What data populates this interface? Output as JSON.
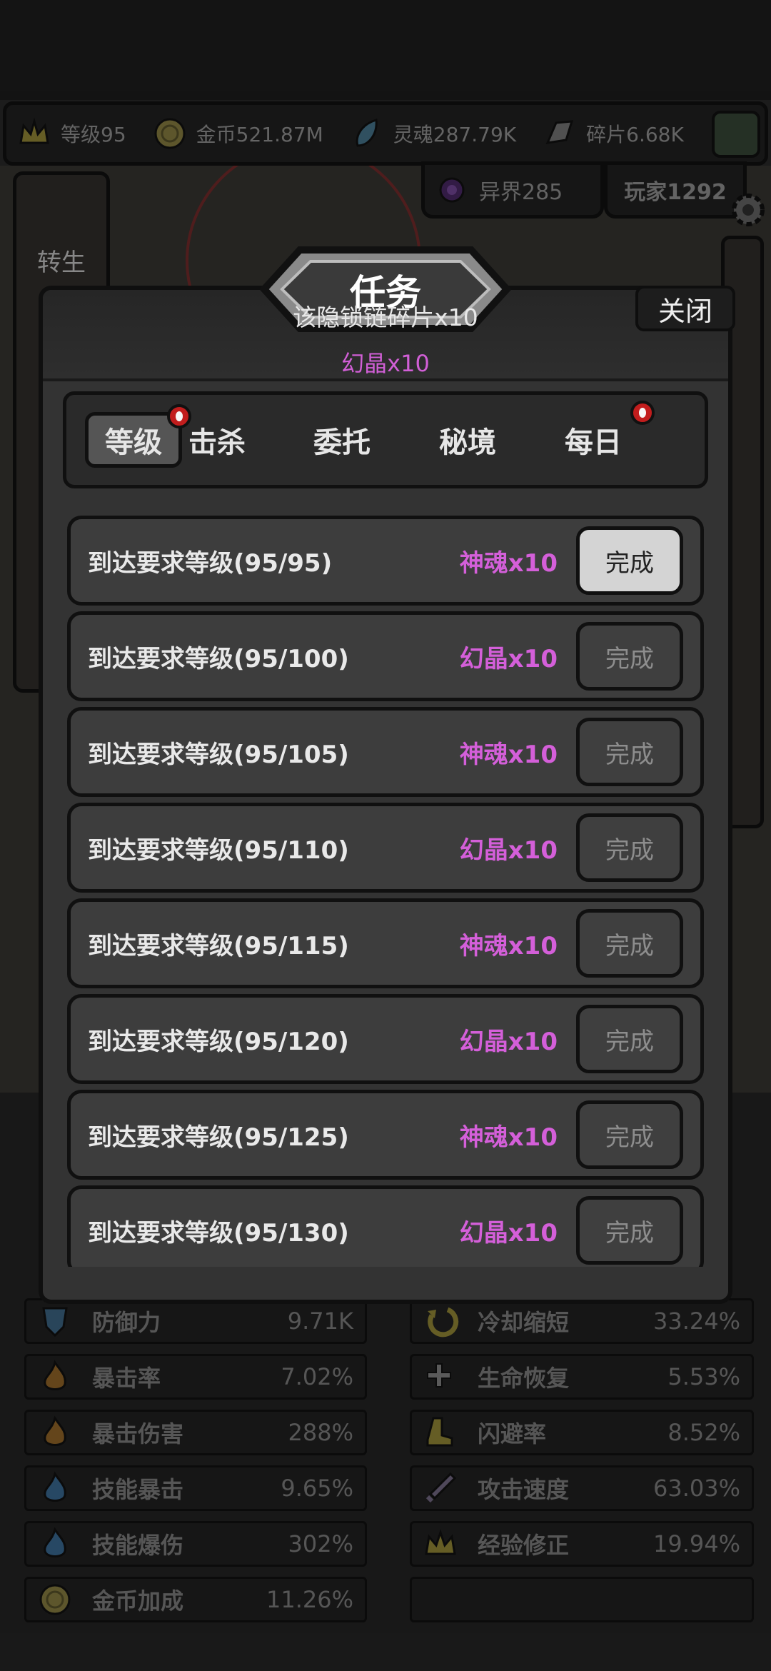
{
  "top_stats": [
    {
      "label": "等级95",
      "icon": "crown-icon"
    },
    {
      "label": "金币521.87M",
      "icon": "coin-icon"
    },
    {
      "label": "灵魂287.79K",
      "icon": "soul-icon"
    },
    {
      "label": "碎片6.68K",
      "icon": "shard-icon"
    }
  ],
  "sub_tabs": {
    "realm": "异界285",
    "player": "玩家1292"
  },
  "side": {
    "rebirth": "转生"
  },
  "modal": {
    "title": "任务",
    "close": "关闭",
    "toast": "该隐锁链碎片x10",
    "toast_sub": "幻晶x10"
  },
  "tabs": [
    {
      "label": "等级",
      "active": true,
      "badge": true
    },
    {
      "label": "击杀",
      "active": false,
      "badge": false
    },
    {
      "label": "委托",
      "active": false,
      "badge": false
    },
    {
      "label": "秘境",
      "active": false,
      "badge": false
    },
    {
      "label": "每日",
      "active": false,
      "badge": true
    }
  ],
  "quests": [
    {
      "text": "到达要求等级(95/95)",
      "reward": "神魂x10",
      "button": "完成",
      "ready": true
    },
    {
      "text": "到达要求等级(95/100)",
      "reward": "幻晶x10",
      "button": "完成",
      "ready": false
    },
    {
      "text": "到达要求等级(95/105)",
      "reward": "神魂x10",
      "button": "完成",
      "ready": false
    },
    {
      "text": "到达要求等级(95/110)",
      "reward": "幻晶x10",
      "button": "完成",
      "ready": false
    },
    {
      "text": "到达要求等级(95/115)",
      "reward": "神魂x10",
      "button": "完成",
      "ready": false
    },
    {
      "text": "到达要求等级(95/120)",
      "reward": "幻晶x10",
      "button": "完成",
      "ready": false
    },
    {
      "text": "到达要求等级(95/125)",
      "reward": "神魂x10",
      "button": "完成",
      "ready": false
    },
    {
      "text": "到达要求等级(95/130)",
      "reward": "幻晶x10",
      "button": "完成",
      "ready": false
    }
  ],
  "attributes_left": [
    {
      "label": "防御力",
      "value": "9.71K",
      "icon": "shield-icon"
    },
    {
      "label": "暴击率",
      "value": "7.02%",
      "icon": "flame-icon"
    },
    {
      "label": "暴击伤害",
      "value": "288%",
      "icon": "flame-icon"
    },
    {
      "label": "技能暴击",
      "value": "9.65%",
      "icon": "blue-flame-icon"
    },
    {
      "label": "技能爆伤",
      "value": "302%",
      "icon": "blue-flame-icon"
    },
    {
      "label": "金币加成",
      "value": "11.26%",
      "icon": "coin-icon"
    }
  ],
  "attributes_right": [
    {
      "label": "冷却缩短",
      "value": "33.24%",
      "icon": "cooldown-icon"
    },
    {
      "label": "生命恢复",
      "value": "5.53%",
      "icon": "health-regen-icon"
    },
    {
      "label": "闪避率",
      "value": "8.52%",
      "icon": "boot-icon"
    },
    {
      "label": "攻击速度",
      "value": "63.03%",
      "icon": "sword-icon"
    },
    {
      "label": "经验修正",
      "value": "19.94%",
      "icon": "crown-icon"
    }
  ],
  "colors": {
    "reward": "#d45fd9",
    "badge": "#c21d1d"
  }
}
